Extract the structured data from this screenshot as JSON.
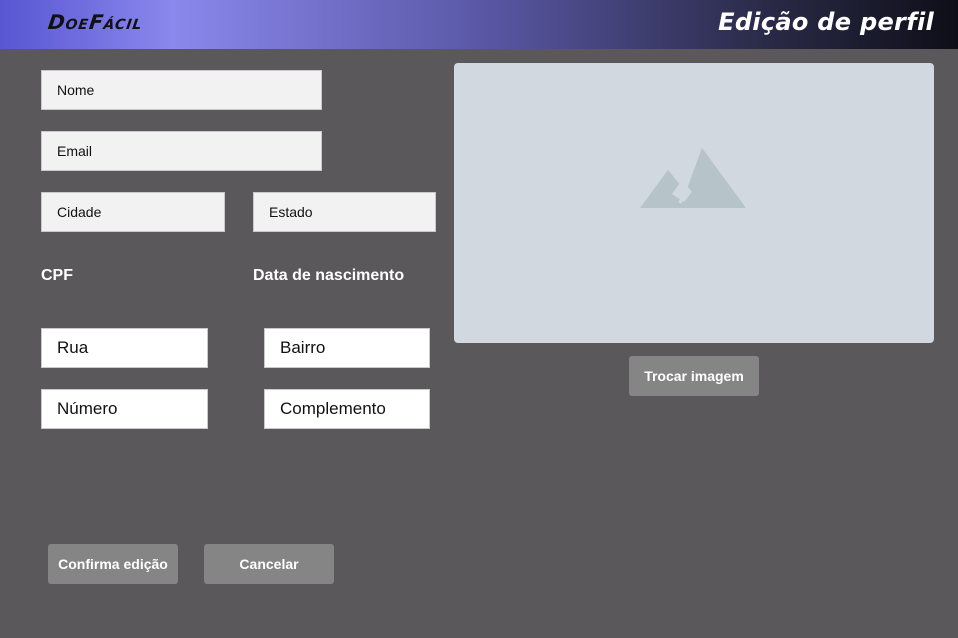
{
  "header": {
    "logo_text": "DoeFácil",
    "title": "Edição de perfil"
  },
  "form": {
    "nome": "Nome",
    "email": "Email",
    "cidade": "Cidade",
    "estado": "Estado",
    "cpf_label": "CPF",
    "nascimento_label": "Data de nascimento",
    "rua": "Rua",
    "bairro": "Bairro",
    "numero": "Número",
    "complemento": "Complemento"
  },
  "image": {
    "icon": "image-placeholder-icon",
    "change_button": "Trocar imagem"
  },
  "actions": {
    "confirm": "Confirma edição",
    "cancel": "Cancelar"
  }
}
